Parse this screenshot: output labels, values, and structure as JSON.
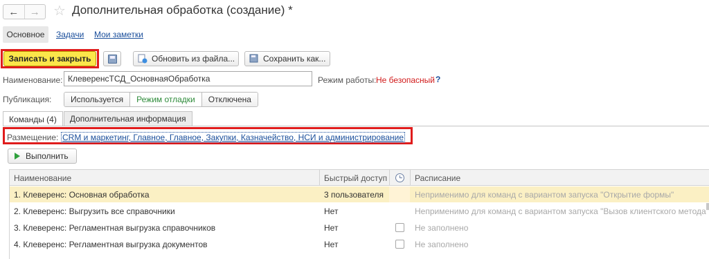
{
  "window": {
    "title": "Дополнительная обработка (создание) *",
    "back_glyph": "←",
    "forward_glyph": "→",
    "star_glyph": "☆"
  },
  "top_tabs": {
    "main": "Основное",
    "tasks": "Задачи",
    "notes": "Мои заметки"
  },
  "toolbar": {
    "save_close": "Записать и закрыть",
    "update_from_file": "Обновить из файла...",
    "save_as": "Сохранить как..."
  },
  "form": {
    "name_label": "Наименование:",
    "name_value": "КлеверенсТСД_ОсновнаяОбработка",
    "mode_label": "Режим работы:",
    "mode_value": "Не безопасный",
    "help": "?",
    "publication_label": "Публикация:",
    "publication_options": [
      "Используется",
      "Режим отладки",
      "Отключена"
    ],
    "publication_selected": "Режим отладки"
  },
  "tabs": [
    "Команды (4)",
    "Дополнительная информация"
  ],
  "placement": {
    "label": "Размещение:",
    "value": "CRM и маркетинг, Главное, Главное, Закупки, Казначейство, НСИ и администрирование"
  },
  "run_button": "Выполнить",
  "table": {
    "columns": {
      "name": "Наименование",
      "access": "Быстрый доступ",
      "schedule": "Расписание"
    },
    "rows": [
      {
        "name": "1. Клеверенс: Основная обработка",
        "access": "3 пользователя",
        "schedule": "Неприменимо для команд с вариантом запуска \"Открытие формы\"",
        "checkbox": false
      },
      {
        "name": "2. Клеверенс: Выгрузить все справочники",
        "access": "Нет",
        "schedule": "Неприменимо для команд с вариантом запуска \"Вызов клиентского метода\"",
        "checkbox": false
      },
      {
        "name": "3. Клеверенс: Регламентная выгрузка справочников",
        "access": "Нет",
        "schedule": "Не заполнено",
        "checkbox": true
      },
      {
        "name": "4. Клеверенс: Регламентная выгрузка документов",
        "access": "Нет",
        "schedule": "Не заполнено",
        "checkbox": true
      }
    ]
  },
  "colors": {
    "accent_yellow": "#fce64a",
    "highlight_red": "#e01c1c",
    "link_blue": "#1a4e9b",
    "warning_red": "#d11a1a",
    "selected_row": "#fbf0c4"
  }
}
